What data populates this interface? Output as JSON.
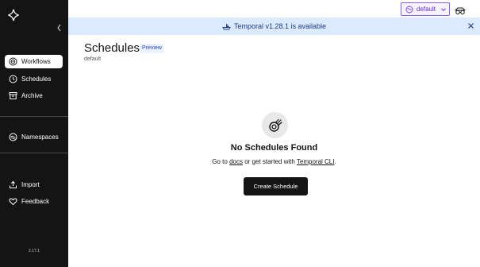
{
  "sidebar": {
    "items": [
      {
        "label": "Workflows",
        "icon": "workflows-icon"
      },
      {
        "label": "Schedules",
        "icon": "schedules-icon"
      },
      {
        "label": "Archive",
        "icon": "archive-icon"
      },
      {
        "label": "Namespaces",
        "icon": "namespaces-icon"
      },
      {
        "label": "Import",
        "icon": "import-icon"
      },
      {
        "label": "Feedback",
        "icon": "feedback-icon"
      }
    ],
    "version": "2.17.1"
  },
  "header": {
    "namespace": "default"
  },
  "banner": {
    "text": "Temporal v1.28.1 is available"
  },
  "main": {
    "title": "Schedules",
    "badge": "Preview",
    "namespace": "default",
    "empty": {
      "title": "No Schedules Found",
      "text_prefix": "Go to",
      "docs_link": "docs",
      "text_middle": "or get started with",
      "cli_link": "Temporal CLI",
      "text_suffix": ".",
      "button": "Create Schedule"
    }
  },
  "colors": {
    "sidebar_bg": "#141414",
    "banner_bg": "#dbeafe",
    "namespace_accent": "#8b5cf6",
    "button_bg": "#141414"
  }
}
